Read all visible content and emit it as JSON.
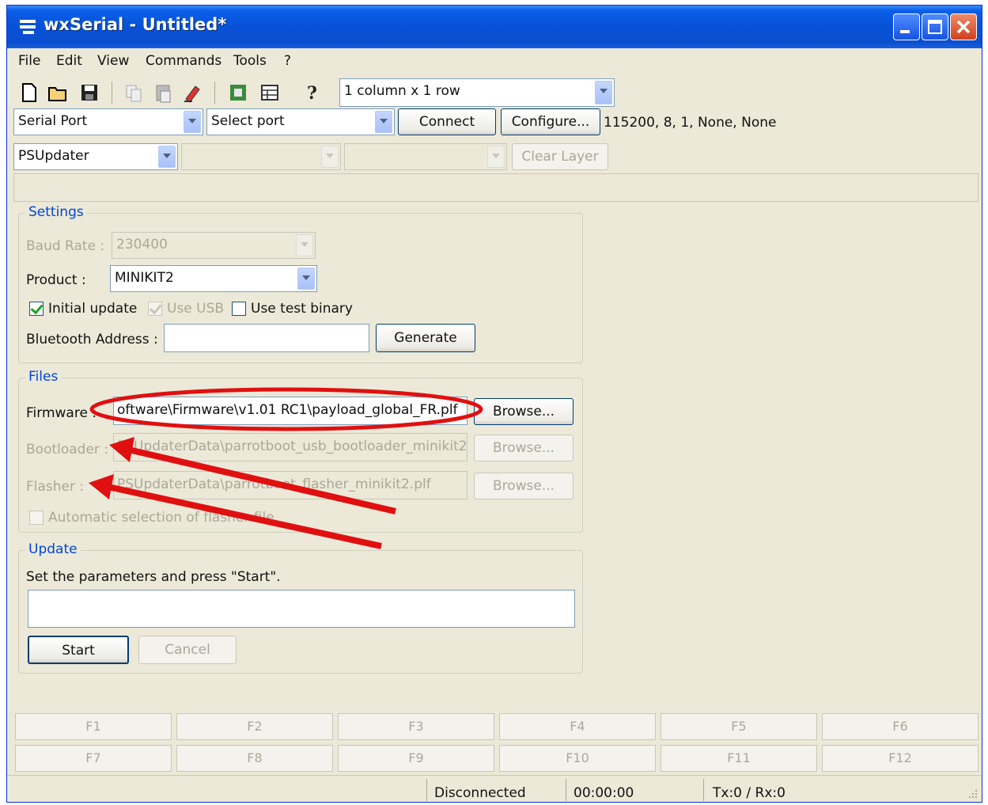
{
  "window": {
    "title": "wxSerial - Untitled*"
  },
  "menu": [
    "File",
    "Edit",
    "View",
    "Commands",
    "Tools",
    "?"
  ],
  "toolbar": {
    "layout_combo": "1 column x 1 row"
  },
  "connection": {
    "port_type": "Serial Port",
    "port_select": "Select port",
    "connect_label": "Connect",
    "configure_label": "Configure...",
    "settings_text": "115200, 8, 1, None, None"
  },
  "layer": {
    "plugin": "PSUpdater",
    "clear_label": "Clear Layer"
  },
  "settings": {
    "group_label": "Settings",
    "baud_label": "Baud Rate :",
    "baud_value": "230400",
    "product_label": "Product :",
    "product_value": "MINIKIT2",
    "initial_update_label": "Initial update",
    "use_usb_label": "Use USB",
    "use_test_binary_label": "Use test binary",
    "bt_label": "Bluetooth Address :",
    "bt_value": "",
    "generate_label": "Generate"
  },
  "files": {
    "group_label": "Files",
    "firmware_label": "Firmware :",
    "firmware_value": "oftware\\Firmware\\v1.01 RC1\\payload_global_FR.plf",
    "bootloader_label": "Bootloader :",
    "bootloader_value": "PSUpdaterData\\parrotboot_usb_bootloader_minikit2",
    "flasher_label": "Flasher :",
    "flasher_value": "PSUpdaterData\\parrotboot_flasher_minikit2.plf",
    "browse_label": "Browse...",
    "auto_select_label": "Automatic selection of flasher file"
  },
  "update": {
    "group_label": "Update",
    "message": "Set the parameters and press \"Start\".",
    "start_label": "Start",
    "cancel_label": "Cancel"
  },
  "fkeys": [
    "F1",
    "F2",
    "F3",
    "F4",
    "F5",
    "F6",
    "F7",
    "F8",
    "F9",
    "F10",
    "F11",
    "F12"
  ],
  "status": {
    "state": "Disconnected",
    "time": "00:00:00",
    "traffic": "Tx:0 / Rx:0"
  },
  "colors": {
    "annotation": "#e01010",
    "titlebar": "#0851d6",
    "group_label": "#0046d5"
  }
}
